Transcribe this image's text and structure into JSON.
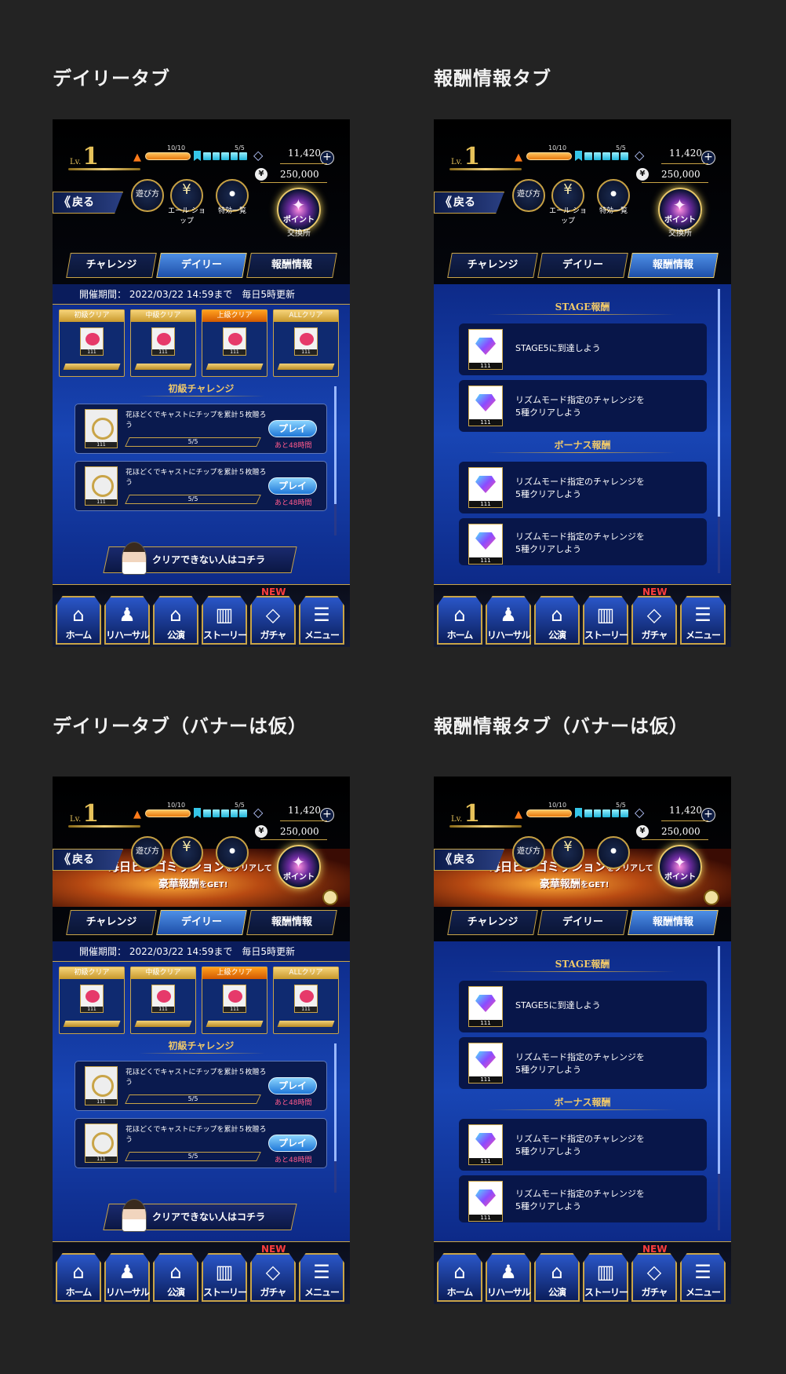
{
  "panels": {
    "p1_title": "デイリータブ",
    "p2_title": "報酬情報タブ",
    "p3_title": "デイリータブ（バナーは仮）",
    "p4_title": "報酬情報タブ（バナーは仮）"
  },
  "header": {
    "lv_label": "Lv.",
    "level": "1",
    "stamina": "10/10",
    "bp": "5/5",
    "gems": "11,420",
    "plus": "+",
    "yen_symbol": "¥",
    "yen": "250,000",
    "back_label": "戻る",
    "back_chevron": "《",
    "howto_label": "遊び方",
    "ale_shop_label": "エール ショップ",
    "tokko_label": "特効一覧",
    "point_label": "ポイント",
    "point_sub_label": "交換所"
  },
  "banner": {
    "line1_a": "毎日ビンゴミッション",
    "line1_b": "をクリアして",
    "line2_a": "豪華報酬",
    "line2_b": "をGET!"
  },
  "tabs": [
    "チャレンジ",
    "デイリー",
    "報酬情報"
  ],
  "daily": {
    "period_label": "開催期間：",
    "period_date": "2022/03/22 14:59まで",
    "period_reset": "毎日5時更新",
    "ranks": [
      {
        "label": "初級クリア",
        "card_no": "111"
      },
      {
        "label": "中級クリア",
        "card_no": "111"
      },
      {
        "label": "上級クリア",
        "card_no": "111"
      },
      {
        "label": "ALLクリア",
        "card_no": "111"
      }
    ],
    "section_title": "初級チャレンジ",
    "challenges": [
      {
        "text": "花ほどくでキャストにチップを累計５枚贈ろう",
        "progress": "5/5",
        "button": "プレイ",
        "remain": "あと48時間",
        "thumb_no": "111"
      },
      {
        "text": "花ほどくでキャストにチップを累計５枚贈ろう",
        "progress": "5/5",
        "button": "プレイ",
        "remain": "あと48時間",
        "thumb_no": "111"
      }
    ],
    "help_button": "クリアできない人はコチラ"
  },
  "reward": {
    "stage_title": "STAGE報酬",
    "bonus_title": "ボーナス報酬",
    "stage_items": [
      {
        "line1": "STAGE5に到達しよう",
        "line2": "",
        "thumb_no": "111"
      },
      {
        "line1": "リズムモード指定のチャレンジを",
        "line2": "5種クリアしよう",
        "thumb_no": "111"
      }
    ],
    "bonus_items": [
      {
        "line1": "リズムモード指定のチャレンジを",
        "line2": "5種クリアしよう",
        "thumb_no": "111"
      },
      {
        "line1": "リズムモード指定のチャレンジを",
        "line2": "5種クリアしよう",
        "thumb_no": "111"
      }
    ]
  },
  "nav": {
    "items": [
      "ホーム",
      "リハーサル",
      "公演",
      "ストーリー",
      "ガチャ",
      "メニュー"
    ],
    "icons": [
      "home-icon",
      "rehearsal-icon",
      "performance-icon",
      "story-icon",
      "gacha-icon",
      "menu-icon"
    ],
    "new_badge": "NEW"
  },
  "colors": {
    "gold": "#c9a447",
    "blue": "#1845b4",
    "new": "#ff3d3d"
  }
}
